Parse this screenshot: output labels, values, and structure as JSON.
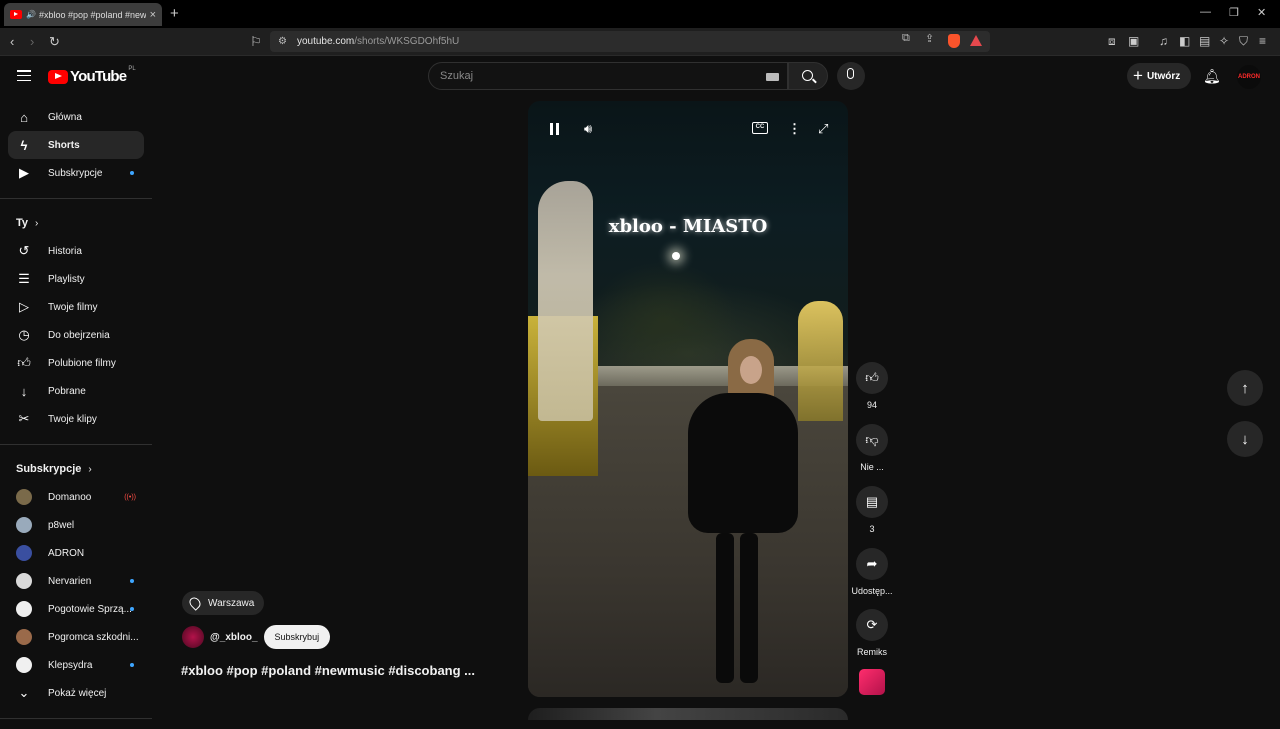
{
  "browser": {
    "tab_title": "#xbloo #pop #poland #newm",
    "url_host": "youtube.com",
    "url_path": "/shorts/WKSGDOhf5hU"
  },
  "header": {
    "logo_text": "YouTube",
    "logo_country": "PL",
    "search_placeholder": "Szukaj",
    "create_label": "Utwórz",
    "avatar_text": "ADRON"
  },
  "sidebar": {
    "main": [
      {
        "label": "Główna",
        "icon": "home-icon"
      },
      {
        "label": "Shorts",
        "icon": "shorts-icon"
      },
      {
        "label": "Subskrypcje",
        "icon": "subscriptions-icon"
      }
    ],
    "you_heading": "Ty",
    "you": [
      {
        "label": "Historia",
        "icon": "history-icon"
      },
      {
        "label": "Playlisty",
        "icon": "playlists-icon"
      },
      {
        "label": "Twoje filmy",
        "icon": "your-videos-icon"
      },
      {
        "label": "Do obejrzenia",
        "icon": "watch-later-icon"
      },
      {
        "label": "Polubione filmy",
        "icon": "liked-icon"
      },
      {
        "label": "Pobrane",
        "icon": "download-icon"
      },
      {
        "label": "Twoje klipy",
        "icon": "clips-icon"
      }
    ],
    "subs_heading": "Subskrypcje",
    "subscriptions": [
      {
        "label": "Domanoo",
        "color": "#7a6a4a"
      },
      {
        "label": "p8wel",
        "color": "#9ab"
      },
      {
        "label": "ADRON",
        "color": "#3a4fa0"
      },
      {
        "label": "Nervarien",
        "color": "#d9d9d9"
      },
      {
        "label": "Pogotowie Sprzą...",
        "color": "#eeeeee"
      },
      {
        "label": "Pogromca szkodni...",
        "color": "#9a6a4a"
      },
      {
        "label": "Klepsydra",
        "color": "#f0f0f0"
      }
    ],
    "show_more": "Pokaż więcej"
  },
  "short": {
    "overlay_title": "xbloo - MIASTO",
    "location": "Warszawa",
    "channel": "@_xbloo_",
    "subscribe_label": "Subskrybuj",
    "description": "#xbloo #pop #poland #newmusic #discobang ..."
  },
  "actions": {
    "like_count": "94",
    "dislike_label": "Nie ...",
    "comment_count": "3",
    "share_label": "Udostęp...",
    "remix_label": "Remiks"
  }
}
